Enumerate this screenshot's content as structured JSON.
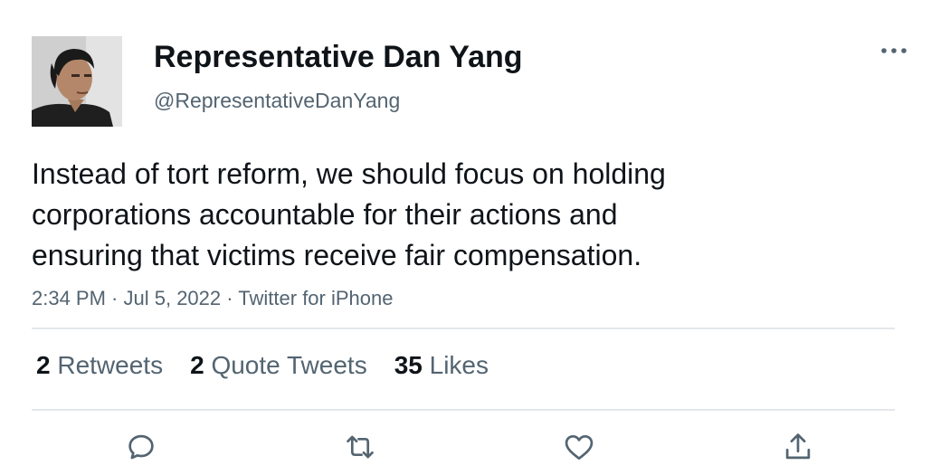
{
  "author": {
    "display_name": "Representative Dan Yang",
    "handle": "@RepresentativeDanYang"
  },
  "tweet": {
    "lines": [
      "Instead of tort reform, we should focus on holding",
      "corporations accountable for their actions and",
      "ensuring that victims receive fair compensation."
    ],
    "time": "2:34 PM",
    "separator": " · ",
    "date": "Jul 5, 2022",
    "source": "Twitter for iPhone"
  },
  "stats": {
    "retweets_count": "2",
    "retweets_label": "Retweets",
    "quotes_count": "2",
    "quotes_label": "Quote Tweets",
    "likes_count": "35",
    "likes_label": "Likes"
  },
  "icons": {
    "more": "more-icon",
    "reply": "reply-icon",
    "retweet": "retweet-icon",
    "like": "heart-icon",
    "share": "share-icon"
  },
  "colors": {
    "text_primary": "#0f1419",
    "text_secondary": "#536471",
    "divider": "#e4e7ea"
  }
}
